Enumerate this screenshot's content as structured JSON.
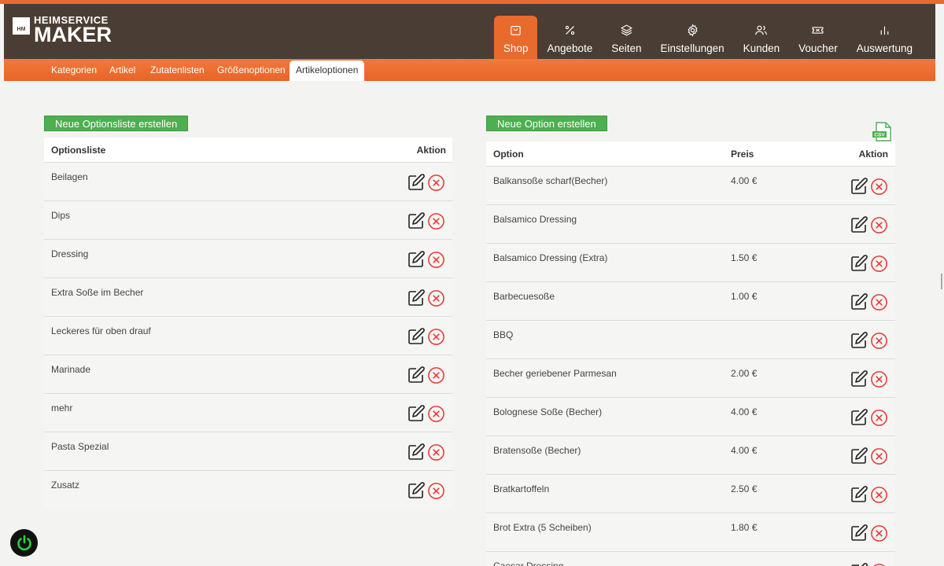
{
  "app": {
    "logo_box": "HM",
    "logo_line1": "HEIMSERVICE",
    "logo_line2": "MAKER"
  },
  "nav": [
    {
      "label": "Shop",
      "icon": "shopping-bag-icon",
      "active": true
    },
    {
      "label": "Angebote",
      "icon": "percent-icon"
    },
    {
      "label": "Seiten",
      "icon": "layers-icon"
    },
    {
      "label": "Einstellungen",
      "icon": "gear-icon"
    },
    {
      "label": "Kunden",
      "icon": "users-icon"
    },
    {
      "label": "Voucher",
      "icon": "ticket-icon"
    },
    {
      "label": "Auswertung",
      "icon": "bar-chart-icon"
    }
  ],
  "subnav": [
    {
      "label": "Kategorien"
    },
    {
      "label": "Artikel"
    },
    {
      "label": "Zutatenlisten"
    },
    {
      "label": "Größenoptionen"
    },
    {
      "label": "Artikeloptionen",
      "active": true
    }
  ],
  "left": {
    "button_label": "Neue Optionsliste erstellen",
    "col_name": "Optionsliste",
    "col_action": "Aktion",
    "rows": [
      {
        "name": "Beilagen"
      },
      {
        "name": "Dips"
      },
      {
        "name": "Dressing"
      },
      {
        "name": "Extra Soße im Becher"
      },
      {
        "name": "Leckeres für oben drauf"
      },
      {
        "name": "Marinade"
      },
      {
        "name": "mehr"
      },
      {
        "name": "Pasta Spezial"
      },
      {
        "name": "Zusatz"
      }
    ]
  },
  "right": {
    "button_label": "Neue Option erstellen",
    "csv_label": "CSV",
    "col_option": "Option",
    "col_price": "Preis",
    "col_action": "Aktion",
    "rows": [
      {
        "name": "Balkansoße scharf(Becher)",
        "price": "4.00 €"
      },
      {
        "name": "Balsamico Dressing",
        "price": ""
      },
      {
        "name": "Balsamico Dressing (Extra)",
        "price": "1.50 €"
      },
      {
        "name": "Barbecuesoße",
        "price": "1.00 €"
      },
      {
        "name": "BBQ",
        "price": ""
      },
      {
        "name": "Becher geriebener Parmesan",
        "price": "2.00 €"
      },
      {
        "name": "Bolognese Soße (Becher)",
        "price": "4.00 €"
      },
      {
        "name": "Bratensoße (Becher)",
        "price": "4.00 €"
      },
      {
        "name": "Bratkartoffeln",
        "price": "2.50 €"
      },
      {
        "name": "Brot Extra (5 Scheiben)",
        "price": "1.80 €"
      },
      {
        "name": "Caesar Dressing",
        "price": ""
      }
    ]
  },
  "colors": {
    "header_bg": "#4a3e34",
    "accent": "#e86a2c",
    "button_green": "#4caf50",
    "delete_red": "#e53935",
    "power_green": "#2ecc40"
  }
}
